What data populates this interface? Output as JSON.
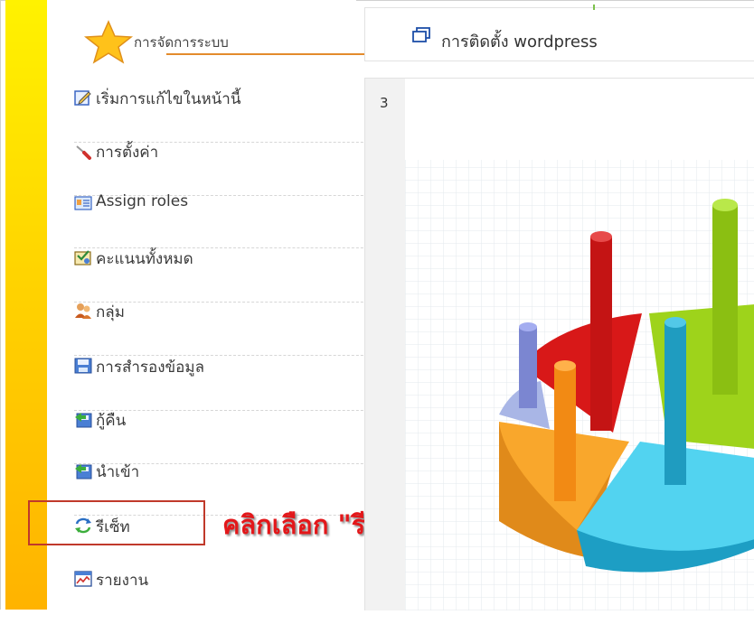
{
  "block": {
    "title": "การจัดการระบบ"
  },
  "menu": [
    {
      "label": "เริ่มการแก้ไขในหน้านี้",
      "icon": "edit-page-icon"
    },
    {
      "label": "การตั้งค่า",
      "icon": "screwdriver-icon"
    },
    {
      "label": "Assign roles",
      "icon": "assign-roles-icon"
    },
    {
      "label": "คะแนนทั้งหมด",
      "icon": "grades-icon"
    },
    {
      "label": "กลุ่ม",
      "icon": "groups-icon"
    },
    {
      "label": "การสำรองข้อมูล",
      "icon": "backup-icon"
    },
    {
      "label": "กู้คืน",
      "icon": "restore-icon"
    },
    {
      "label": "นำเข้า",
      "icon": "import-icon"
    },
    {
      "label": "รีเซ็ท",
      "icon": "reset-icon"
    },
    {
      "label": "รายงาน",
      "icon": "reports-icon"
    }
  ],
  "callout": "คลิกเลือก \"รีเซ็ท\"",
  "tab": {
    "label": "การติดตั้ง wordpress"
  },
  "content": {
    "line_number": "3"
  },
  "colors": {
    "sidebar_strip": "#ffd400",
    "accent_underline": "#e38b2c",
    "callout_red": "#e3171a",
    "highlight_border": "#c0392b"
  }
}
